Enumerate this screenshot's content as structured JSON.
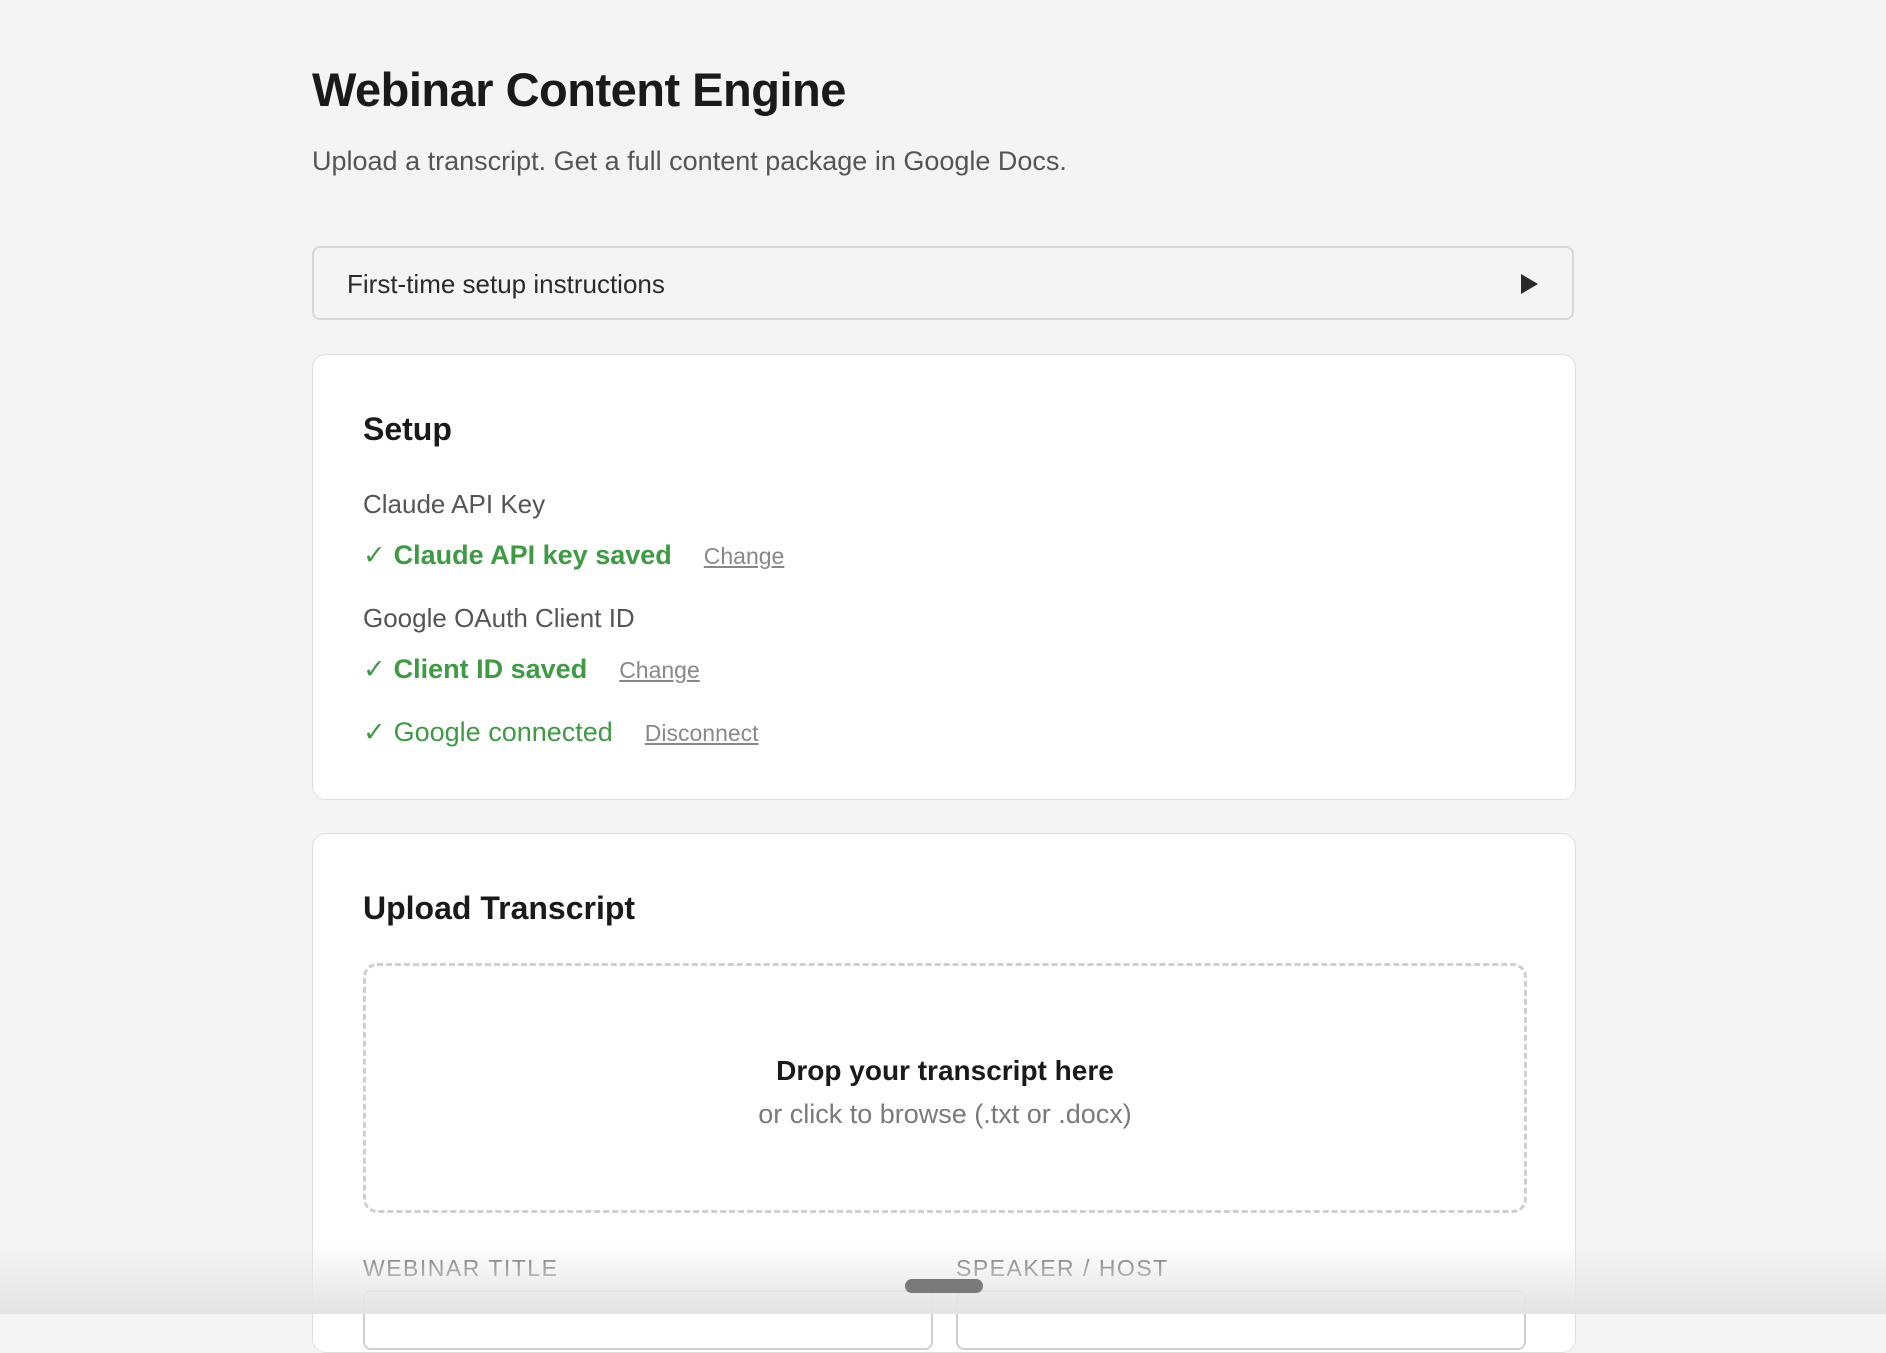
{
  "header": {
    "title": "Webinar Content Engine",
    "subtitle": "Upload a transcript. Get a full content package in Google Docs."
  },
  "setup_instructions": {
    "label": "First-time setup instructions",
    "icon": "play-triangle-icon",
    "expanded": false
  },
  "setup": {
    "title": "Setup",
    "api_key": {
      "label": "Claude API Key",
      "check": "✓",
      "status": "Claude API key saved",
      "action": "Change"
    },
    "client_id": {
      "label": "Google OAuth Client ID",
      "check": "✓",
      "status": "Client ID saved",
      "action": "Change"
    },
    "google": {
      "check": "✓",
      "status": "Google connected",
      "action": "Disconnect"
    }
  },
  "upload": {
    "title": "Upload Transcript",
    "dropzone_title": "Drop your transcript here",
    "dropzone_sub": "or click to browse (.txt or .docx)",
    "webinar_title_label": "WEBINAR TITLE",
    "webinar_title_placeholder": "",
    "speaker_label": "SPEAKER / HOST",
    "speaker_placeholder": ""
  },
  "colors": {
    "success": "#3e9a44",
    "background": "#f4f4f4",
    "card": "#ffffff"
  }
}
